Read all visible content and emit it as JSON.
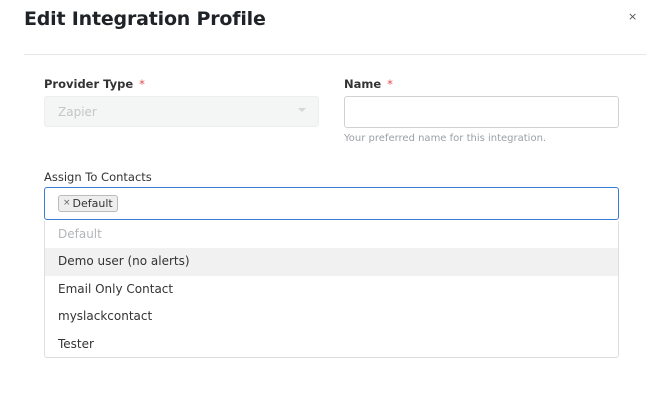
{
  "dialog": {
    "title": "Edit Integration Profile",
    "close_glyph": "×"
  },
  "form": {
    "provider_type": {
      "label": "Provider Type",
      "required_mark": "*",
      "value": "Zapier",
      "disabled": true
    },
    "name": {
      "label": "Name",
      "required_mark": "*",
      "value": "",
      "help": "Your preferred name for this integration."
    },
    "assign_contacts": {
      "label": "Assign To Contacts",
      "selected_tags": [
        "Default"
      ],
      "tag_remove_glyph": "×",
      "options": [
        {
          "label": "Default",
          "disabled": true
        },
        {
          "label": "Demo user (no alerts)",
          "highlighted": true
        },
        {
          "label": "Email Only Contact"
        },
        {
          "label": "myslackcontact"
        },
        {
          "label": "Tester"
        }
      ]
    }
  },
  "colors": {
    "focus_border": "#3a7bd5",
    "required": "#e5484d",
    "highlight": "#f1f1f1"
  }
}
